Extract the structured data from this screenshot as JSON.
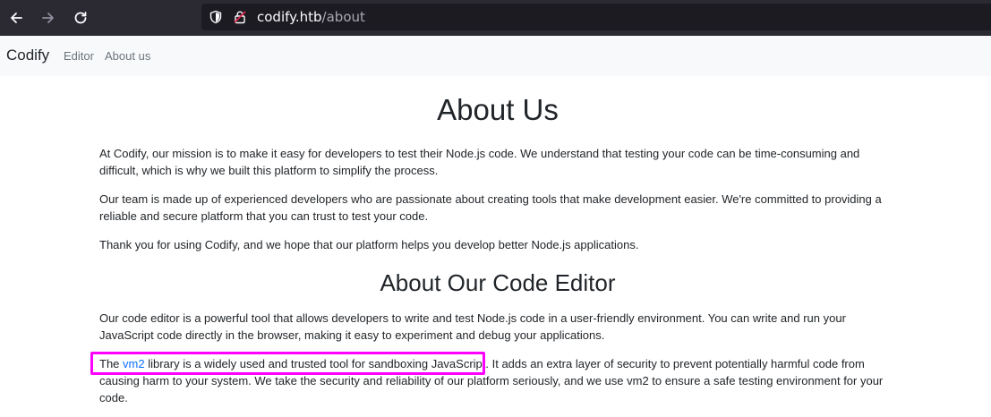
{
  "browser": {
    "url_host": "codify.htb",
    "url_path": "/about",
    "icons": [
      "back-icon",
      "forward-icon",
      "reload-icon",
      "shield-icon",
      "lock-icon"
    ]
  },
  "navbar": {
    "brand": "Codify",
    "links": [
      "Editor",
      "About us"
    ]
  },
  "main": {
    "heading_about": "About Us",
    "paragraphs_about": [
      "At Codify, our mission is to make it easy for developers to test their Node.js code. We understand that testing your code can be time-consuming and difficult, which is why we built this platform to simplify the process.",
      "Our team is made up of experienced developers who are passionate about creating tools that make development easier. We're committed to providing a reliable and secure platform that you can trust to test your code.",
      "Thank you for using Codify, and we hope that our platform helps you develop better Node.js applications."
    ],
    "heading_editor": "About Our Code Editor",
    "paragraph_editor": "Our code editor is a powerful tool that allows developers to write and test Node.js code in a user-friendly environment. You can write and run your JavaScript code directly in the browser, making it easy to experiment and debug your applications.",
    "vm2": {
      "prefix": "The ",
      "link": "vm2",
      "suffix": " library is a widely used and trusted tool for sandboxing JavaScript. It adds an extra layer of security to prevent potentially harmful code from causing harm to your system. We take the security and reliability of our platform seriously, and we use vm2 to ensure a safe testing environment for your code."
    }
  },
  "colors": {
    "toolbar_bg": "#2b2a33",
    "urlbar_bg": "#1c1b22",
    "navbar_bg": "#f8f9fa",
    "link": "#0d6efd",
    "highlight": "#ff00ff"
  }
}
